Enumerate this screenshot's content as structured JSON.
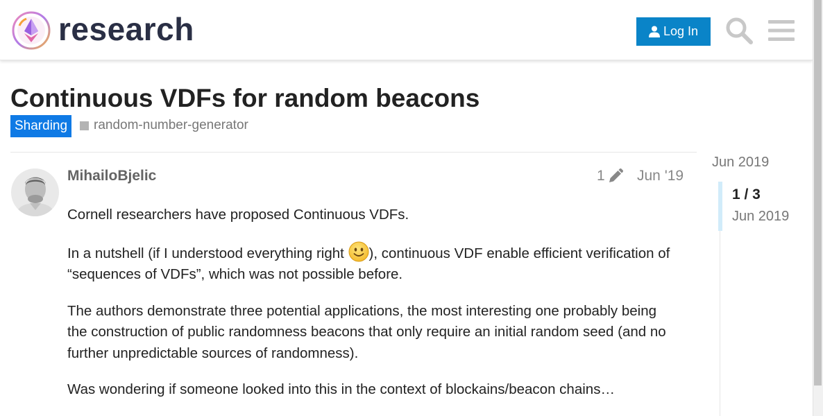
{
  "header": {
    "site_name": "research",
    "login_label": "Log In",
    "icons": [
      "ethereum-logo",
      "user-icon",
      "search-icon",
      "hamburger-menu-icon"
    ]
  },
  "topic": {
    "title": "Continuous VDFs for random beacons",
    "category": "Sharding",
    "tag": "random-number-generator"
  },
  "post": {
    "username": "MihailoBjelic",
    "edit_count": "1",
    "date": "Jun '19",
    "paragraphs": {
      "p1": "Cornell researchers have proposed Continuous VDFs.",
      "p2_before": "In a nutshell (if I understood everything right ",
      "p2_after": "), continuous VDF enable efficient verification of “sequences of VDFs”, which was not possible before.",
      "p3": "The authors demonstrate three potential applications, the most interesting one probably being the construction of public randomness beacons that only require an initial random seed (and no further unpredictable sources of randomness).",
      "p4": "Was wondering if someone looked into this in the context of blockains/beacon chains…"
    }
  },
  "timeline": {
    "top_date": "Jun 2019",
    "counter": "1 / 3",
    "current_date": "Jun 2019"
  },
  "colors": {
    "login_button": "#0a84c8",
    "category_badge": "#0f7ae5",
    "timeline_handle": "#d1ecfa",
    "logo_text": "#2a2f45"
  }
}
